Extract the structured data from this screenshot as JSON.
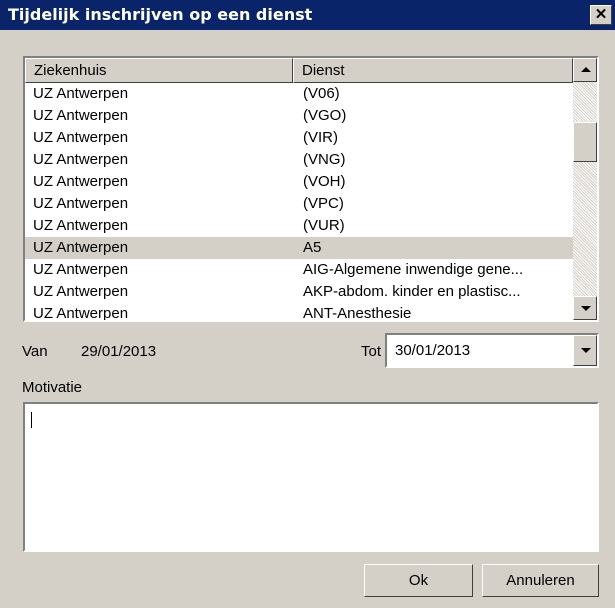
{
  "window": {
    "title": "Tijdelijk inschrijven op een dienst",
    "close_glyph": "✕"
  },
  "list": {
    "columns": [
      "Ziekenhuis",
      "Dienst"
    ],
    "rows": [
      {
        "hospital": "UZ Antwerpen",
        "service": "(V06)"
      },
      {
        "hospital": "UZ Antwerpen",
        "service": "(VGO)"
      },
      {
        "hospital": "UZ Antwerpen",
        "service": "(VIR)"
      },
      {
        "hospital": "UZ Antwerpen",
        "service": "(VNG)"
      },
      {
        "hospital": "UZ Antwerpen",
        "service": "(VOH)"
      },
      {
        "hospital": "UZ Antwerpen",
        "service": "(VPC)"
      },
      {
        "hospital": "UZ Antwerpen",
        "service": "(VUR)"
      },
      {
        "hospital": "UZ Antwerpen",
        "service": "A5",
        "selected": true
      },
      {
        "hospital": "UZ Antwerpen",
        "service": "AIG-Algemene inwendige gene..."
      },
      {
        "hospital": "UZ Antwerpen",
        "service": "AKP-abdom. kinder en plastisc..."
      },
      {
        "hospital": "UZ Antwerpen",
        "service": "ANT-Anesthesie"
      }
    ]
  },
  "van": {
    "label": "Van",
    "value": "29/01/2013"
  },
  "tot": {
    "label": "Tot",
    "value": "30/01/2013"
  },
  "motivatie": {
    "label": "Motivatie",
    "value": ""
  },
  "buttons": {
    "ok": "Ok",
    "cancel": "Annuleren"
  },
  "colors": {
    "titlebar": "#0a246a",
    "face": "#d4d0c8",
    "selection": "#d4d0c8"
  }
}
